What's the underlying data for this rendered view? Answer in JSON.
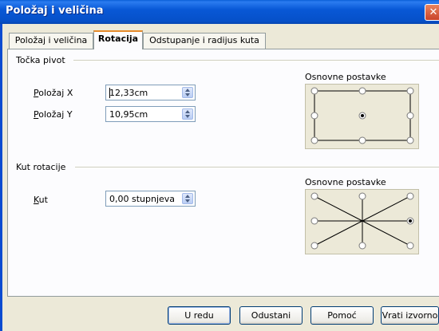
{
  "window": {
    "title": "Položaj i veličina",
    "close_glyph": "✕"
  },
  "tabs": [
    {
      "label": "Položaj i veličina",
      "active": false
    },
    {
      "label": "Rotacija",
      "active": true
    },
    {
      "label": "Odstupanje i radijus kuta",
      "active": false
    }
  ],
  "pivot": {
    "section_label": "Točka pivot",
    "pos_x_label": "Položaj X",
    "pos_x_value": "12,33cm",
    "pos_y_label": "Položaj Y",
    "pos_y_value": "10,95cm",
    "defaults_label": "Osnovne postavke",
    "selected_point": "center"
  },
  "rotation": {
    "section_label": "Kut rotacije",
    "angle_label": "Kut",
    "angle_value": "0,00 stupnjeva",
    "defaults_label": "Osnovne postavke",
    "selected_point": "right-middle"
  },
  "buttons": {
    "ok": "U redu",
    "cancel": "Odustani",
    "help": "Pomoć",
    "reset": "Vrati izvorno"
  },
  "colors": {
    "titlebar": "#0858d6",
    "active_tab_accent": "#e68b2c",
    "dialog_bg": "#ece9d8"
  }
}
